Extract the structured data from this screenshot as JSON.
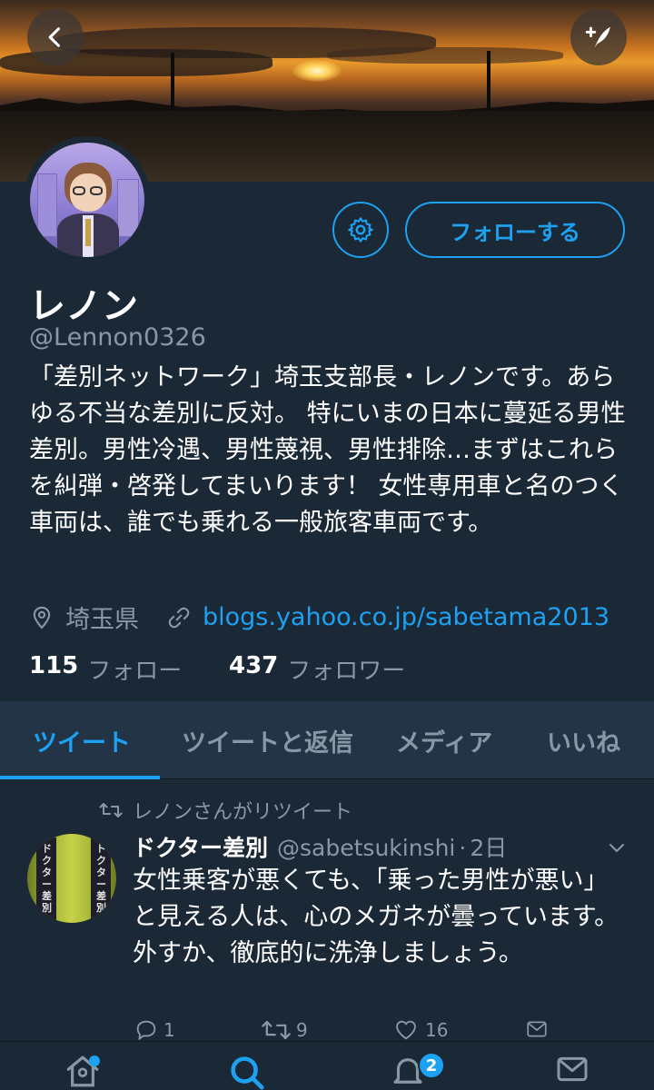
{
  "profile": {
    "name": "レノン",
    "handle": "@Lennon0326",
    "bio": "「差別ネットワーク」埼玉支部長・レノンです。あらゆる不当な差別に反対。 特にいまの日本に蔓延る男性差別。男性冷遇、男性蔑視、男性排除…まずはこれらを糾弾・啓発してまいります！ 女性専用車と名のつく車両は、誰でも乗れる一般旅客車両です。",
    "location": "埼玉県",
    "url": "blogs.yahoo.co.jp/sabetama2013",
    "following_count": "115",
    "following_label": "フォロー",
    "followers_count": "437",
    "followers_label": "フォロワー",
    "follow_button": "フォローする"
  },
  "tabs": [
    {
      "label": "ツイート",
      "active": true
    },
    {
      "label": "ツイートと返信",
      "active": false
    },
    {
      "label": "メディア",
      "active": false
    },
    {
      "label": "いいね",
      "active": false
    }
  ],
  "tweet": {
    "retweet_note": "レノンさんがリツイート",
    "author": "ドクター差別",
    "handle": "@sabetsukinshi",
    "separator": "·",
    "time": "2日",
    "text": "女性乗客が悪くても、「乗った男性が悪い」と見える人は、心のメガネが曇っています。外すか、徹底的に洗浄しましょう。",
    "avatar_text": "ドクター差別",
    "replies": "1",
    "retweets": "9",
    "likes": "16"
  },
  "nav": {
    "notification_badge": "2"
  },
  "colors": {
    "background": "#1b2836",
    "accent": "#1da1f2",
    "secondary_text": "#8899a6",
    "tab_bar": "#243447"
  },
  "icons": [
    "back-arrow-icon",
    "compose-icon",
    "gear-icon",
    "location-pin-icon",
    "link-icon",
    "retweet-icon",
    "chevron-down-icon",
    "reply-icon",
    "like-icon",
    "message-icon",
    "home-icon",
    "search-icon",
    "notifications-icon",
    "mail-icon"
  ]
}
